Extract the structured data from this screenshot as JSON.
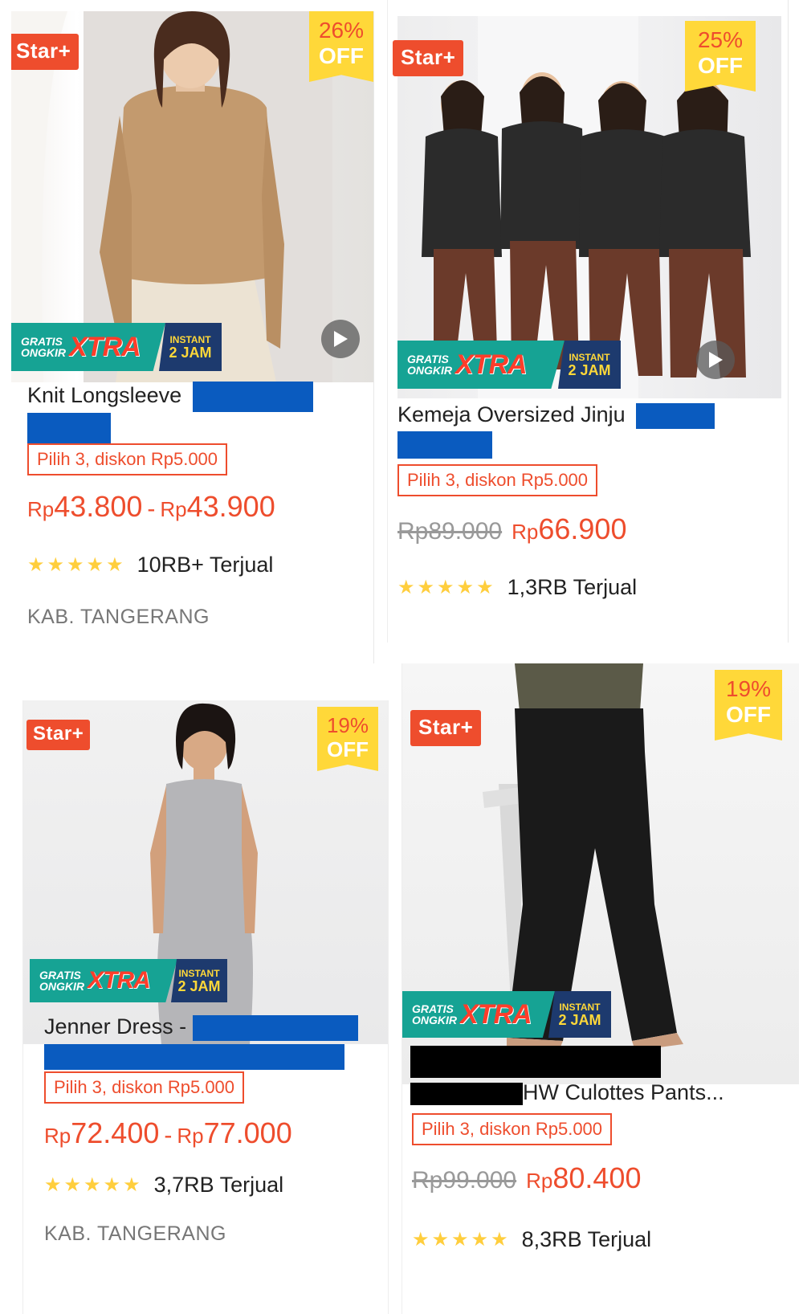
{
  "colors": {
    "accent": "#ee4d2d",
    "star_badge": "#ee4d2d",
    "discount_badge_bg": "#ffd839",
    "rating_star": "#ffce3d",
    "xtra_green": "#16a394",
    "xtra_navy": "#1d3a6e",
    "redaction_blue": "#0a5bbf",
    "redaction_black": "#000000"
  },
  "products": [
    {
      "star_badge": "Star+",
      "discount_pct": "26%",
      "discount_off": "OFF",
      "banner": {
        "gratis_line1": "GRATIS",
        "gratis_line2": "ONGKIR",
        "xtra": "XTRA",
        "instant": "INSTANT",
        "jam": "2 JAM"
      },
      "title": "Knit Longsleeve",
      "promo": "Pilih 3, diskon Rp5.000",
      "price_currency_a": "Rp",
      "price_min": "43.800",
      "price_dash": "-",
      "price_currency_b": "Rp",
      "price_max": "43.900",
      "stars": "★★★★★",
      "sold": "10RB+ Terjual",
      "location": "KAB. TANGERANG",
      "icon": "play-icon"
    },
    {
      "star_badge": "Star+",
      "discount_pct": "25%",
      "discount_off": "OFF",
      "banner": {
        "gratis_line1": "GRATIS",
        "gratis_line2": "ONGKIR",
        "xtra": "XTRA",
        "instant": "INSTANT",
        "jam": "2 JAM"
      },
      "title": "Kemeja Oversized Jinju",
      "promo": "Pilih 3, diskon Rp5.000",
      "old_price": "Rp89.000",
      "price_currency": "Rp",
      "price": "66.900",
      "stars": "★★★★★",
      "sold": "1,3RB Terjual",
      "icon": "play-icon"
    },
    {
      "star_badge": "Star+",
      "discount_pct": "19%",
      "discount_off": "OFF",
      "banner": {
        "gratis_line1": "GRATIS",
        "gratis_line2": "ONGKIR",
        "xtra": "XTRA",
        "instant": "INSTANT",
        "jam": "2 JAM"
      },
      "title": "Jenner Dress -",
      "promo": "Pilih 3, diskon Rp5.000",
      "price_currency_a": "Rp",
      "price_min": "72.400",
      "price_dash": "-",
      "price_currency_b": "Rp",
      "price_max": "77.000",
      "stars": "★★★★★",
      "sold": "3,7RB Terjual",
      "location": "KAB. TANGERANG"
    },
    {
      "star_badge": "Star+",
      "discount_pct": "19%",
      "discount_off": "OFF",
      "banner": {
        "gratis_line1": "GRATIS",
        "gratis_line2": "ONGKIR",
        "xtra": "XTRA",
        "instant": "INSTANT",
        "jam": "2 JAM"
      },
      "title": "HW Culottes Pants...",
      "promo": "Pilih 3, diskon Rp5.000",
      "old_price": "Rp99.000",
      "price_currency": "Rp",
      "price": "80.400",
      "stars": "★★★★★",
      "sold": "8,3RB Terjual"
    }
  ]
}
